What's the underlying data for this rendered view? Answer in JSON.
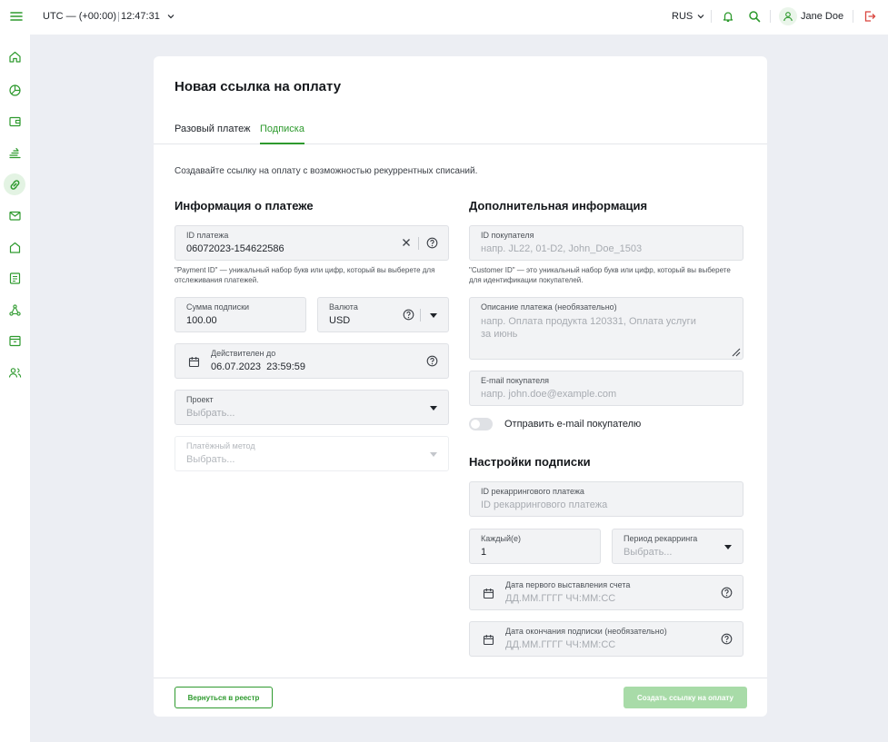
{
  "topbar": {
    "timezone": "UTC — (+00:00)",
    "time": "12:47:31",
    "language": "RUS",
    "user_name": "Jane Doe"
  },
  "page": {
    "title": "Новая ссылка на оплату",
    "tabs": [
      {
        "label": "Разовый платеж",
        "active": false
      },
      {
        "label": "Подписка",
        "active": true
      }
    ],
    "intro": "Создавайте ссылку на оплату с возможностью рекуррентных списаний."
  },
  "payment_info": {
    "title": "Информация о платеже",
    "payment_id": {
      "label": "ID платежа",
      "value": "06072023-154622586"
    },
    "payment_id_hint": "\"Payment ID\" — уникальный набор букв или цифр, который вы выберете для отслеживания платежей.",
    "amount": {
      "label": "Сумма подписки",
      "value": "100.00"
    },
    "currency": {
      "label": "Валюта",
      "value": "USD"
    },
    "valid_until": {
      "label": "Действителен до",
      "value": "06.07.2023  23:59:59"
    },
    "project": {
      "label": "Проект",
      "placeholder": "Выбрать..."
    },
    "payment_method": {
      "label": "Платёжный метод",
      "placeholder": "Выбрать..."
    }
  },
  "additional_info": {
    "title": "Дополнительная информация",
    "customer_id": {
      "label": "ID покупателя",
      "placeholder": "напр. JL22, 01-D2, John_Doe_1503"
    },
    "customer_id_hint": "\"Customer ID\" — это уникальный набор букв или цифр, который вы выберете для идентификации покупателей.",
    "description": {
      "label": "Описание платежа (необязательно)",
      "placeholder": "напр. Оплата продукта 120331, Оплата услуги за июнь"
    },
    "email": {
      "label": "E-mail покупателя",
      "placeholder": "напр. john.doe@example.com"
    },
    "send_email_label": "Отправить e-mail покупателю",
    "send_email_enabled": false
  },
  "subscription_settings": {
    "title": "Настройки подписки",
    "recurring_id": {
      "label": "ID рекаррингового платежа",
      "placeholder": "ID рекаррингового платежа"
    },
    "every": {
      "label": "Каждый(е)",
      "value": "1"
    },
    "period": {
      "label": "Период рекарринга",
      "placeholder": "Выбрать..."
    },
    "first_invoice": {
      "label": "Дата первого выставления счета",
      "placeholder": "ДД.ММ.ГГГГ ЧЧ:ММ:СС"
    },
    "end_date": {
      "label": "Дата окончания подписки (необязательно)",
      "placeholder": "ДД.ММ.ГГГГ ЧЧ:ММ:СС"
    }
  },
  "footer": {
    "back_label": "Вернуться в реестр",
    "create_label": "Создать ссылку на оплату"
  },
  "colors": {
    "accent": "#2e9a2e",
    "accent_disabled": "#a8dba8",
    "background": "#eceef3",
    "field_bg": "#f2f3f5"
  }
}
